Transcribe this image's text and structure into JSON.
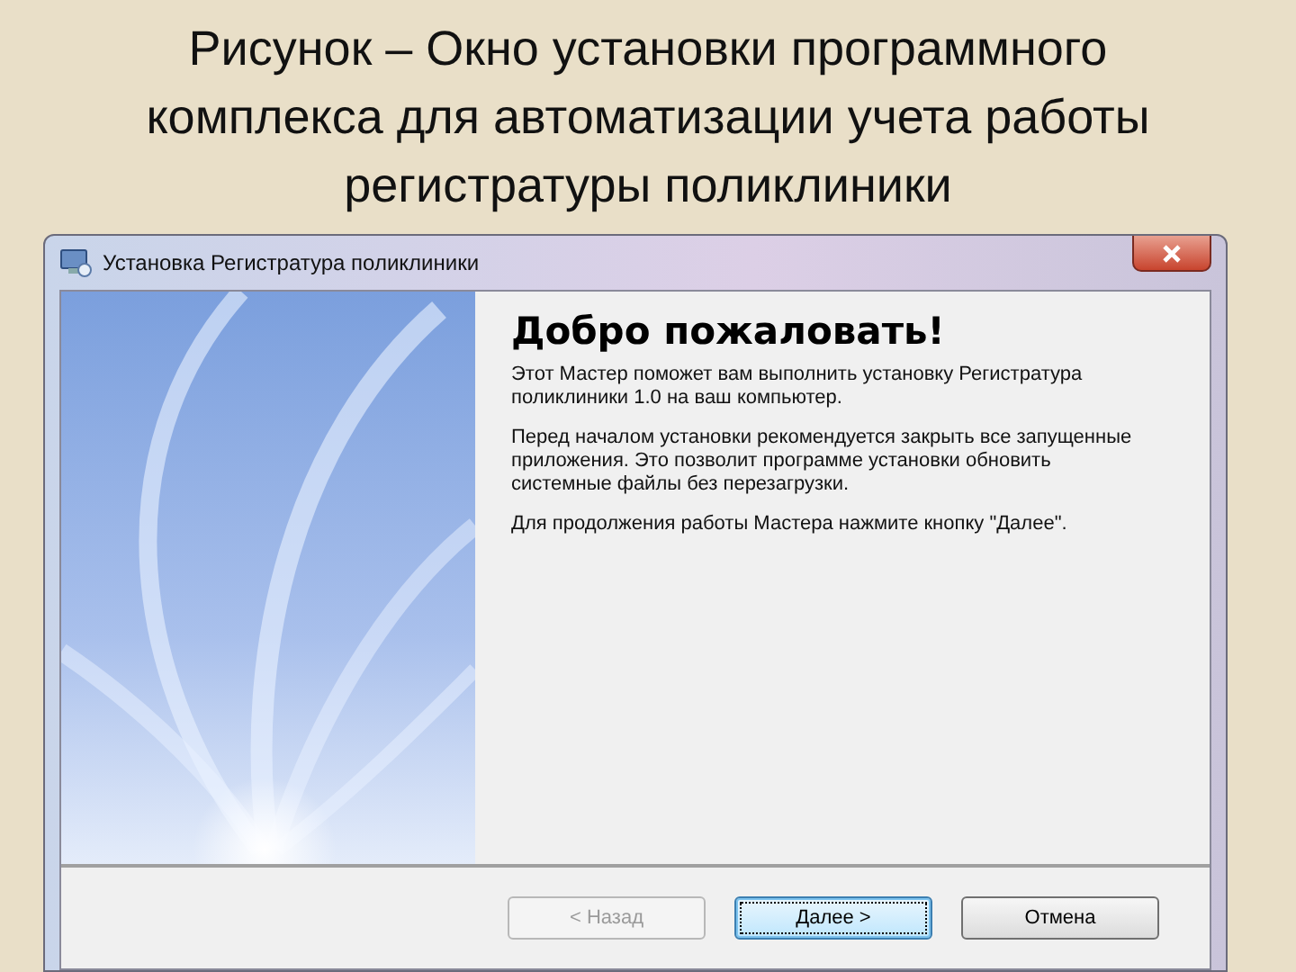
{
  "slide_title": "Рисунок – Окно установки программного комплекса для автоматизации учета работы регистратуры поликлиники",
  "window": {
    "title": "Установка Регистратура поликлиники"
  },
  "heading": "Добро пожаловать!",
  "paragraphs": [
    "Этот Мастер поможет вам выполнить установку Регистратура поликлиники 1.0 на ваш компьютер.",
    "Перед началом установки рекомендуется закрыть все запущенные приложения. Это позволит программе установки обновить системные файлы без перезагрузки.",
    "Для продолжения работы Мастера нажмите кнопку \"Далее\"."
  ],
  "buttons": [
    {
      "label": "< Назад",
      "disabled": true,
      "default": false
    },
    {
      "label": "Далее >",
      "disabled": false,
      "default": true
    },
    {
      "label": "Отмена",
      "disabled": false,
      "default": false
    }
  ]
}
